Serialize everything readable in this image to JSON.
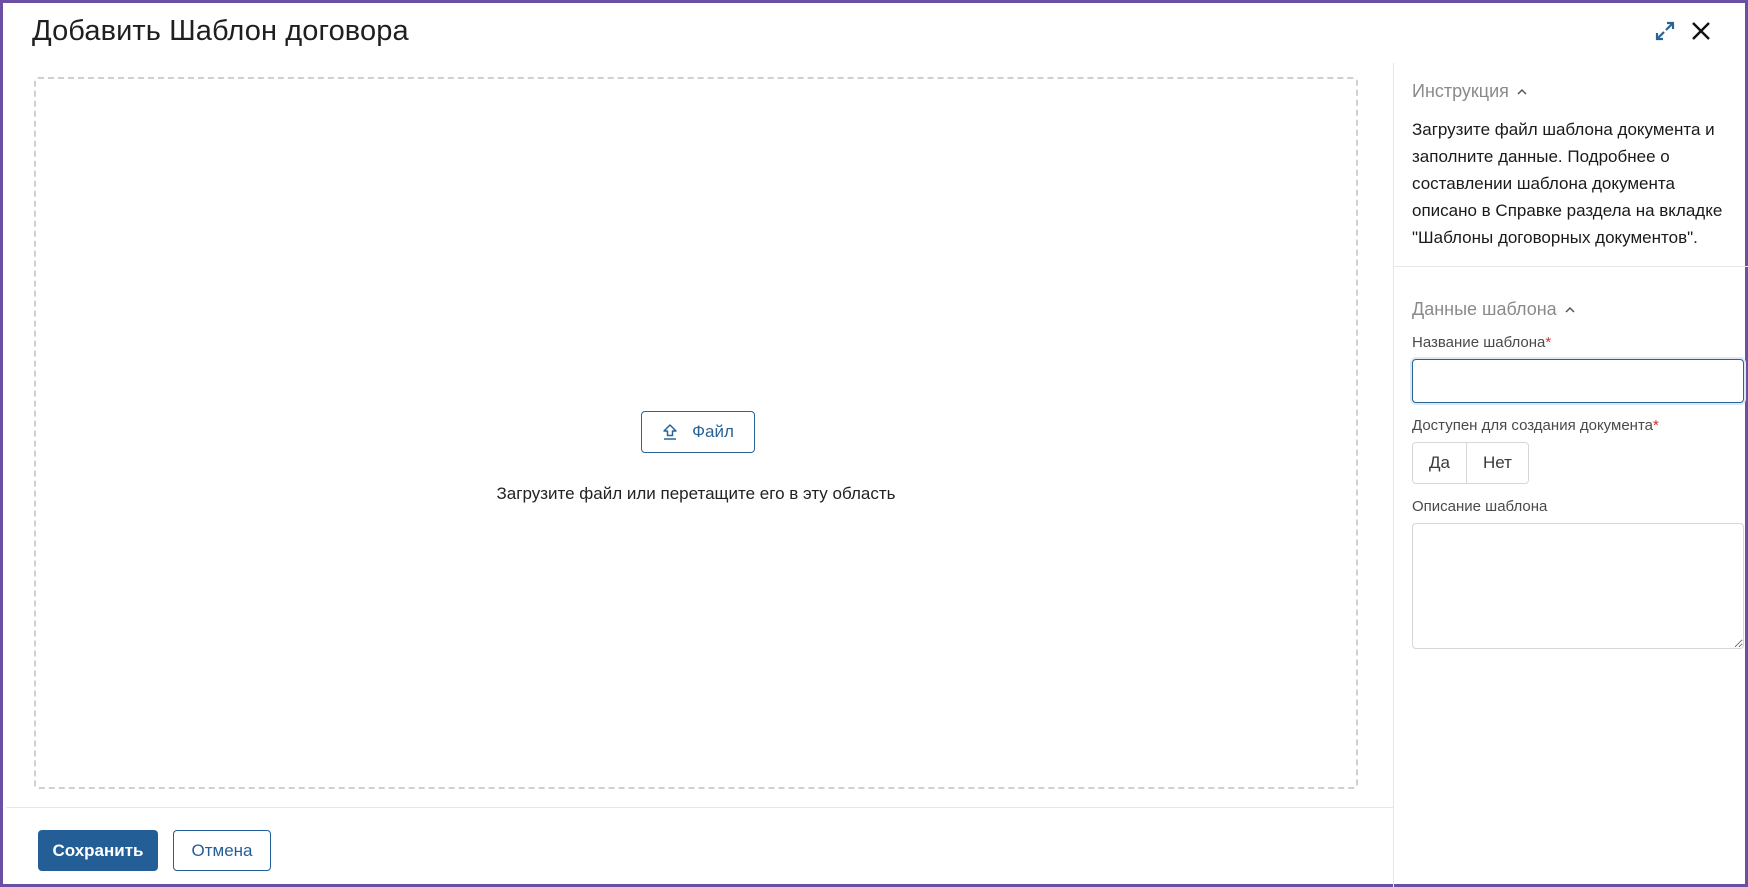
{
  "dialog": {
    "title": "Добавить Шаблон договора"
  },
  "upload": {
    "button_label": "Файл",
    "hint": "Загрузите файл или перетащите его в эту область"
  },
  "footer": {
    "save_label": "Сохранить",
    "cancel_label": "Отмена"
  },
  "sidebar": {
    "instruction": {
      "title": "Инструкция",
      "text": "Загрузите файл шаблона документа и заполните данные. Подробнее о составлении шаблона документа описано в Справке раздела на вкладке \"Шаблоны договорных документов\"."
    },
    "template_data": {
      "title": "Данные шаблона",
      "name_label": "Название шаблона",
      "name_value": "",
      "available_label": "Доступен для создания документа",
      "options": [
        "Да",
        "Нет"
      ],
      "description_label": "Описание шаблона",
      "description_value": "",
      "required_mark": "*"
    }
  },
  "colors": {
    "accent": "#235f96",
    "frame": "#6a4fa3",
    "required": "#d32f2f"
  }
}
